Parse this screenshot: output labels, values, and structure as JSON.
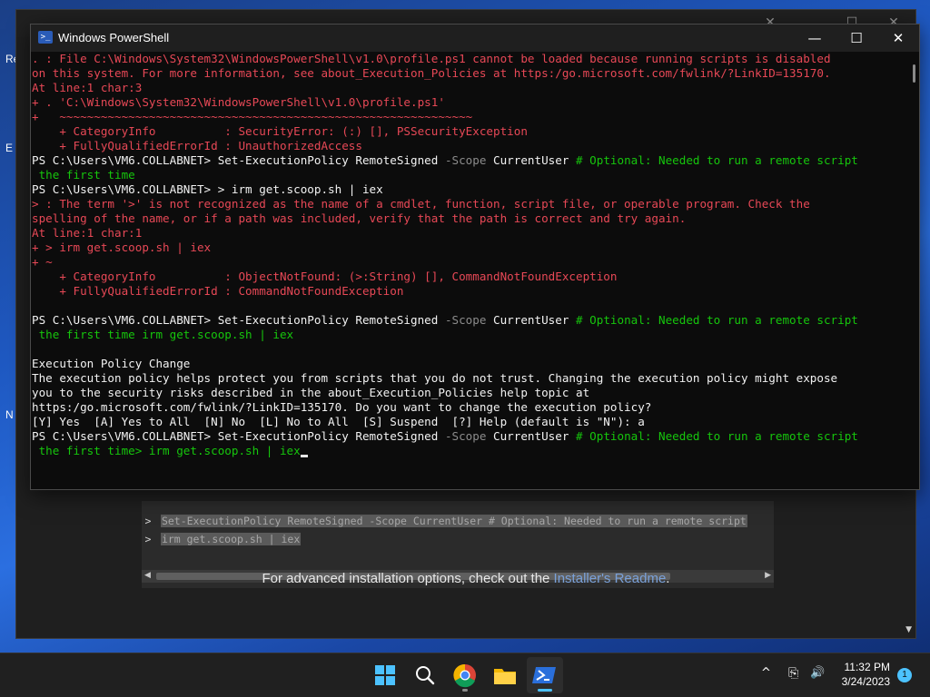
{
  "desktop_fragments": [
    "Re",
    "E",
    "N"
  ],
  "browser": {
    "code_lines": [
      {
        "prompt": ">",
        "text": "Set-ExecutionPolicy RemoteSigned -Scope CurrentUser # Optional: Needed to run a remote script"
      },
      {
        "prompt": ">",
        "text": "irm get.scoop.sh | iex"
      }
    ],
    "advanced_text": "For advanced installation options, check out the ",
    "advanced_link": "Installer's Readme",
    "advanced_end": "."
  },
  "powershell": {
    "title": "Windows PowerShell",
    "icon_glyph": ">_",
    "minimize": "—",
    "maximize": "☐",
    "close": "✕",
    "lines": [
      [
        {
          "c": "red",
          "t": ". : File C:\\Windows\\System32\\WindowsPowerShell\\v1.0\\profile.ps1 cannot be loaded because running scripts is disabled"
        }
      ],
      [
        {
          "c": "red",
          "t": "on this system. For more information, see about_Execution_Policies at https:/go.microsoft.com/fwlink/?LinkID=135170."
        }
      ],
      [
        {
          "c": "red",
          "t": "At line:1 char:3"
        }
      ],
      [
        {
          "c": "red",
          "t": "+ . 'C:\\Windows\\System32\\WindowsPowerShell\\v1.0\\profile.ps1'"
        }
      ],
      [
        {
          "c": "red",
          "t": "+   ~~~~~~~~~~~~~~~~~~~~~~~~~~~~~~~~~~~~~~~~~~~~~~~~~~~~~~~~~~~~"
        }
      ],
      [
        {
          "c": "red",
          "t": "    + CategoryInfo          : SecurityError: (:) [], PSSecurityException"
        }
      ],
      [
        {
          "c": "red",
          "t": "    + FullyQualifiedErrorId : UnauthorizedAccess"
        }
      ],
      [
        {
          "c": "white",
          "t": "PS C:\\Users\\VM6.COLLABNET> "
        },
        {
          "c": "white",
          "t": "Set-ExecutionPolicy RemoteSigned "
        },
        {
          "c": "gray",
          "t": "-Scope "
        },
        {
          "c": "white",
          "t": "CurrentUser "
        },
        {
          "c": "green",
          "t": "# Optional: Needed to run a remote script"
        }
      ],
      [
        {
          "c": "green",
          "t": " the first time"
        }
      ],
      [
        {
          "c": "white",
          "t": "PS C:\\Users\\VM6.COLLABNET> > irm get.scoop.sh | iex"
        }
      ],
      [
        {
          "c": "red",
          "t": "> : The term '>' is not recognized as the name of a cmdlet, function, script file, or operable program. Check the"
        }
      ],
      [
        {
          "c": "red",
          "t": "spelling of the name, or if a path was included, verify that the path is correct and try again."
        }
      ],
      [
        {
          "c": "red",
          "t": "At line:1 char:1"
        }
      ],
      [
        {
          "c": "red",
          "t": "+ > irm get.scoop.sh | iex"
        }
      ],
      [
        {
          "c": "red",
          "t": "+ ~"
        }
      ],
      [
        {
          "c": "red",
          "t": "    + CategoryInfo          : ObjectNotFound: (>:String) [], CommandNotFoundException"
        }
      ],
      [
        {
          "c": "red",
          "t": "    + FullyQualifiedErrorId : CommandNotFoundException"
        }
      ],
      [
        {
          "c": "white",
          "t": ""
        }
      ],
      [
        {
          "c": "white",
          "t": "PS C:\\Users\\VM6.COLLABNET> "
        },
        {
          "c": "white",
          "t": "Set-ExecutionPolicy RemoteSigned "
        },
        {
          "c": "gray",
          "t": "-Scope "
        },
        {
          "c": "white",
          "t": "CurrentUser "
        },
        {
          "c": "green",
          "t": "# Optional: Needed to run a remote script"
        }
      ],
      [
        {
          "c": "green",
          "t": " the first time irm get.scoop.sh | iex"
        }
      ],
      [
        {
          "c": "white",
          "t": ""
        }
      ],
      [
        {
          "c": "white",
          "t": "Execution Policy Change"
        }
      ],
      [
        {
          "c": "white",
          "t": "The execution policy helps protect you from scripts that you do not trust. Changing the execution policy might expose"
        }
      ],
      [
        {
          "c": "white",
          "t": "you to the security risks described in the about_Execution_Policies help topic at"
        }
      ],
      [
        {
          "c": "white",
          "t": "https:/go.microsoft.com/fwlink/?LinkID=135170. Do you want to change the execution policy?"
        }
      ],
      [
        {
          "c": "white",
          "t": "[Y] Yes  [A] Yes to All  [N] No  [L] No to All  [S] Suspend  [?] Help (default is \"N\"): a"
        }
      ],
      [
        {
          "c": "white",
          "t": "PS C:\\Users\\VM6.COLLABNET> "
        },
        {
          "c": "white",
          "t": "Set-ExecutionPolicy RemoteSigned "
        },
        {
          "c": "gray",
          "t": "-Scope "
        },
        {
          "c": "white",
          "t": "CurrentUser "
        },
        {
          "c": "green",
          "t": "# Optional: Needed to run a remote script"
        }
      ],
      [
        {
          "c": "green",
          "t": " the first time> irm get.scoop.sh | iex"
        }
      ]
    ]
  },
  "taskbar": {
    "apps": [
      "start-icon",
      "search-icon",
      "chrome-icon",
      "file-explorer-icon",
      "powershell-icon"
    ],
    "time": "11:32 PM",
    "date": "3/24/2023",
    "notification_count": "1",
    "tray": {
      "chevron": "^",
      "network": "⎘",
      "volume": "🔊"
    }
  },
  "colors": {
    "accent": "#4cc2ff",
    "error": "#e74856",
    "comment": "#16c60c"
  }
}
